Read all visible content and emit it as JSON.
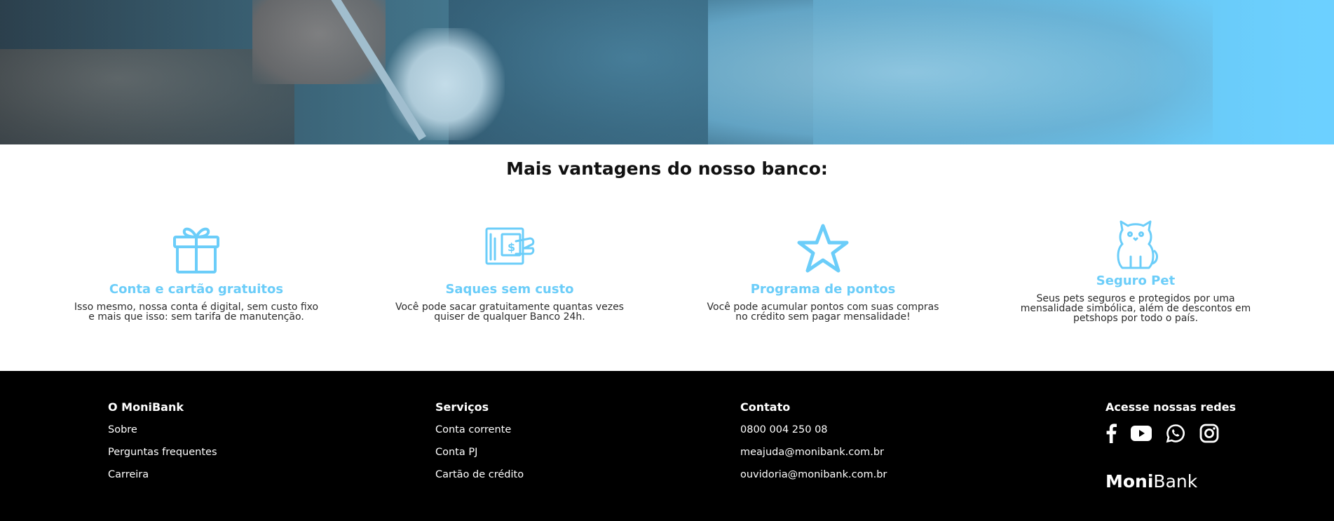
{
  "advantages": {
    "title": "Mais vantagens do nosso banco:",
    "items": [
      {
        "icon": "gift-icon",
        "title": "Conta e cartão gratuitos",
        "lines": [
          "Isso mesmo, nossa conta é digital, sem custo fixo",
          "e mais que isso: sem tarifa de manutenção."
        ]
      },
      {
        "icon": "cash-withdrawal-icon",
        "title": "Saques sem custo",
        "lines": [
          "Você pode sacar gratuitamente quantas vezes",
          "quiser de qualquer Banco 24h."
        ]
      },
      {
        "icon": "star-icon",
        "title": "Programa de pontos",
        "lines": [
          "Você pode acumular pontos com suas compras",
          "no crédito sem pagar mensalidade!"
        ]
      },
      {
        "icon": "cat-icon",
        "title": "Seguro Pet",
        "lines": [
          "Seus pets seguros e protegidos por uma",
          "mensalidade simbólica, além de descontos em",
          "petshops por todo o país."
        ]
      }
    ]
  },
  "footer": {
    "col1": {
      "title": "O MoniBank",
      "links": [
        "Sobre",
        "Perguntas frequentes",
        "Carreira"
      ]
    },
    "col2": {
      "title": "Serviços",
      "links": [
        "Conta corrente",
        "Conta PJ",
        "Cartão de crédito"
      ]
    },
    "col3": {
      "title": "Contato",
      "links": [
        "0800 004 250 08",
        "meajuda@monibank.com.br",
        "ouvidoria@monibank.com.br"
      ]
    },
    "col4": {
      "title": "Acesse nossas redes",
      "socials": [
        "facebook-icon",
        "youtube-icon",
        "whatsapp-icon",
        "instagram-icon"
      ]
    },
    "logo": {
      "bold": "Moni",
      "regular": "Bank"
    }
  },
  "colors": {
    "accent": "#6bcdf9",
    "footer_bg": "#000000"
  }
}
